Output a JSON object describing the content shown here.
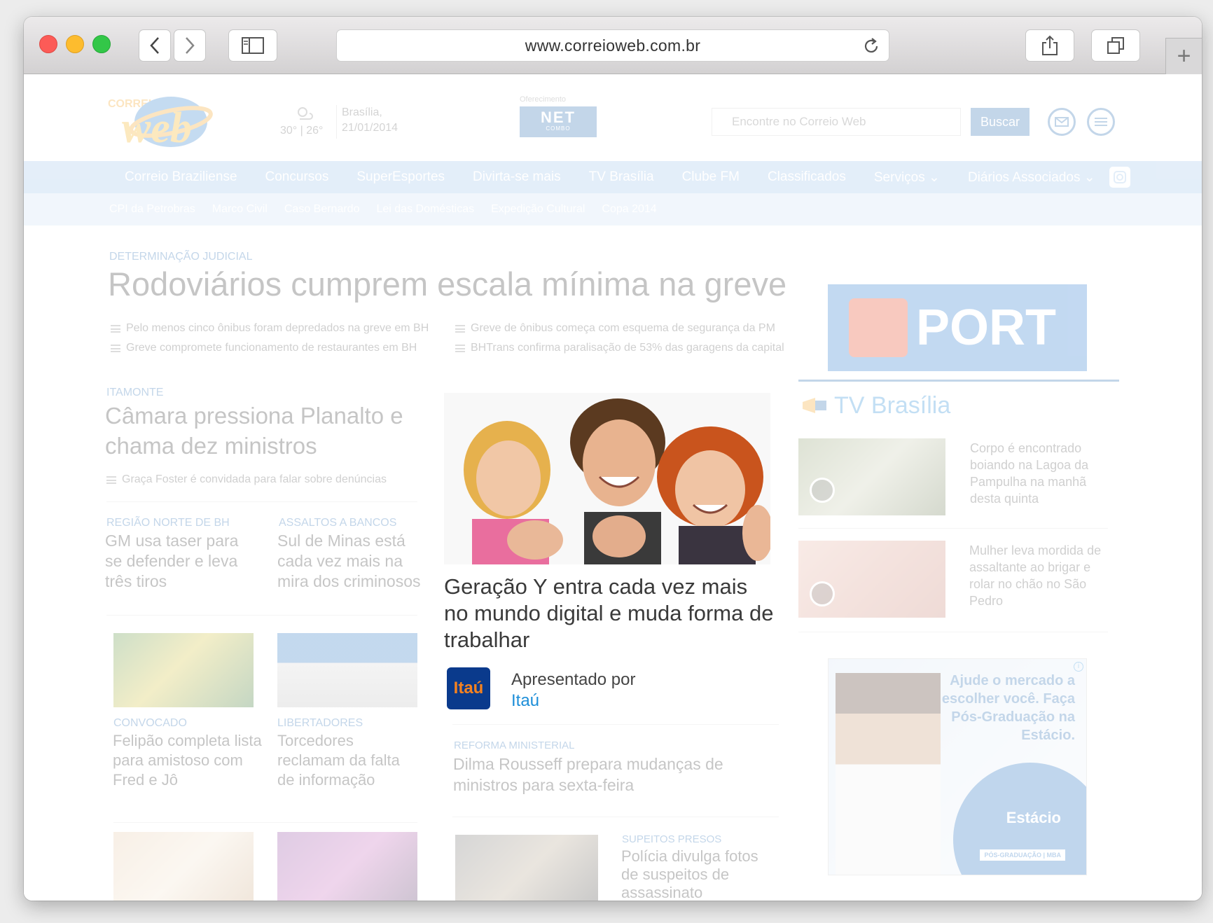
{
  "browser": {
    "url": "www.correioweb.com.br",
    "new_tab": "+"
  },
  "header": {
    "logo_top": "CORREIO",
    "logo_main": "web",
    "weather": "30° | 26°",
    "city": "Brasília,",
    "date": "21/01/2014",
    "sponsor_label": "Oferecimento",
    "sponsor_logo": "NET",
    "sponsor_logo_sub": "COMBO",
    "search_placeholder": "Encontre no Correio Web",
    "search_button": "Buscar"
  },
  "nav_main": [
    "Correio Braziliense",
    "Concursos",
    "SuperEsportes",
    "Divirta-se mais",
    "TV Brasília",
    "Clube FM",
    "Classificados",
    "Serviços ⌄",
    "Diários Associados ⌄"
  ],
  "nav_sub": [
    "CPI da Petrobras",
    "Marco Civil",
    "Caso Bernardo",
    "Lei das Domésticas",
    "Expedição Cultural",
    "Copa 2014"
  ],
  "lead": {
    "kicker": "DETERMINAÇÃO JUDICIAL",
    "headline": "Rodoviários cumprem escala mínima na greve",
    "links": [
      "Pelo menos cinco ônibus foram depredados na greve em BH",
      "Greve de ônibus começa com esquema de segurança da PM",
      "Greve compromete funcionamento de restaurantes em BH",
      "BHTrans confirma paralisação de 53% das garagens da capital"
    ]
  },
  "story_itamonte": {
    "kicker": "ITAMONTE",
    "headline": "Câmara pressiona Planalto e chama dez ministros",
    "link": "Graça Foster é convidada para falar sobre denúncias"
  },
  "small_stories": [
    {
      "kicker": "REGIÃO NORTE DE BH",
      "headline": "GM usa taser para se defender e leva três tiros"
    },
    {
      "kicker": "ASSALTOS A BANCOS",
      "headline": "Sul de Minas está cada vez mais na mira dos criminosos"
    }
  ],
  "photo_stories": [
    {
      "kicker": "CONVOCADO",
      "headline": "Felipão completa lista para amistoso com Fred e Jô"
    },
    {
      "kicker": "LIBERTADORES",
      "headline": "Torcedores reclamam da falta de informação"
    }
  ],
  "featured": {
    "headline": "Geração Y entra cada vez mais no mundo digital e muda forma de trabalhar",
    "presented_by": "Apresentado por",
    "sponsor": "Itaú",
    "sponsor_logo": "Itaú"
  },
  "center_stories": [
    {
      "kicker": "REFORMA MINISTERIAL",
      "headline": "Dilma Rousseff prepara mudanças de ministros para sexta-feira"
    },
    {
      "kicker": "SUPEITOS PRESOS",
      "headline": "Polícia divulga fotos de suspeitos de assassinato"
    }
  ],
  "sidebar": {
    "ad_brand": "PORT",
    "tv_title": "TV Brasília",
    "videos": [
      "Corpo é encontrado boiando na Lagoa da Pampulha na manhã desta quinta",
      "Mulher leva mordida de assaltante ao brigar e rolar no chão no São Pedro"
    ],
    "ad2_text": "Ajude o mercado a escolher você. Faça Pós-Graduação na Estácio.",
    "ad2_brand": "Estácio",
    "ad2_badge": "PÓS-GRADUAÇÃO | MBA"
  },
  "colors": {
    "accent_blue": "#2b6eb4",
    "nav_main_bg": "#9ec3ea",
    "nav_sub_bg": "#cfe2f5",
    "itau_blue": "#0a3a8c",
    "itau_orange": "#f58220",
    "link_blue": "#1d8ed8"
  }
}
